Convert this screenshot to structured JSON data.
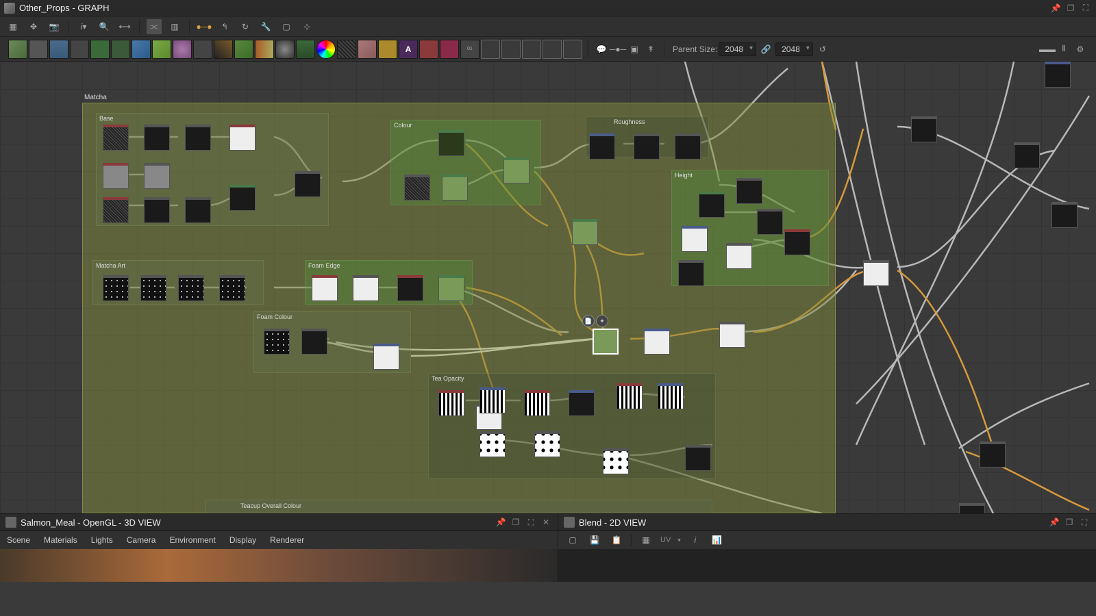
{
  "window": {
    "title": "Other_Props - GRAPH"
  },
  "parent_size": {
    "label": "Parent Size:",
    "width": "2048",
    "height": "2048"
  },
  "graph": {
    "main_frame": "Matcha",
    "sub_frames": {
      "base": "Base",
      "colour": "Colour",
      "roughness": "Roughness",
      "height": "Height",
      "matcha_art": "Matcha Art",
      "foam_edge": "Foam Edge",
      "foam_colour": "Foam Colour",
      "tea_opacity": "Tea Opacity",
      "teacup": "Teacup Overall Colour"
    }
  },
  "panel_3d": {
    "title": "Salmon_Meal - OpenGL - 3D VIEW",
    "menu": {
      "scene": "Scene",
      "materials": "Materials",
      "lights": "Lights",
      "camera": "Camera",
      "environment": "Environment",
      "display": "Display",
      "renderer": "Renderer"
    }
  },
  "panel_2d": {
    "title": "Blend - 2D VIEW",
    "uv_label": "UV"
  },
  "atomic_text_btn": "A",
  "atomic_tiny_btn": "01"
}
